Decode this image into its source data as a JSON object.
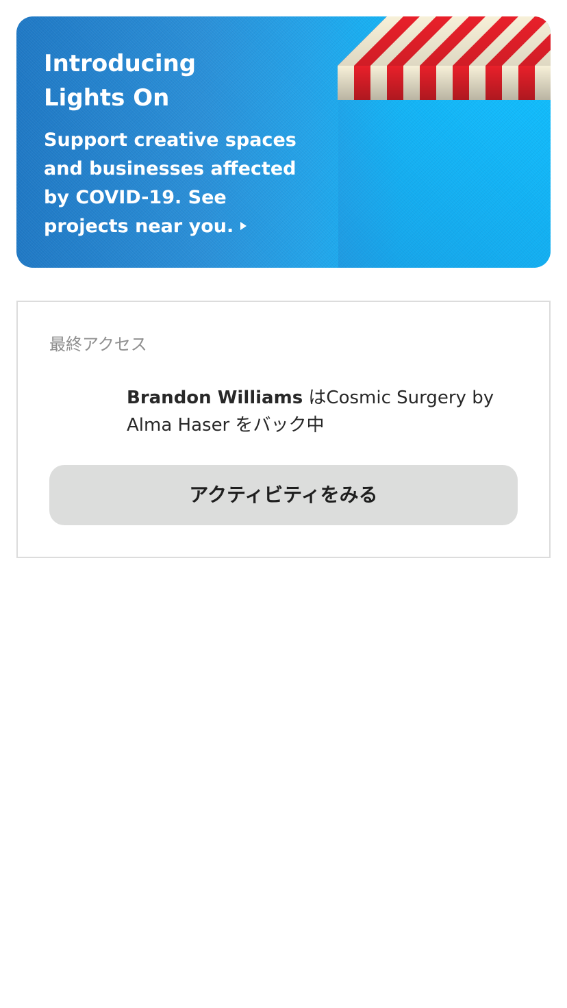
{
  "banner": {
    "title_line1": "Introducing",
    "title_line2": "Lights On",
    "body_line1": "Support creative spaces",
    "body_line2": "and businesses affected",
    "body_line3": "by COVID-19. See",
    "body_line4": "projects near you.",
    "arrow_icon": "play-triangle-icon",
    "illustration_icon": "striped-awning-icon",
    "colors": {
      "gradient_start": "#1f78c4",
      "gradient_end": "#0fbaf9",
      "awning_red": "#e8202a",
      "awning_cream": "#f7f0d8"
    }
  },
  "activity": {
    "section_label": "最終アクセス",
    "user_name": "Brandon Williams",
    "action_line1": " はCosmic Surgery by",
    "action_line2": "Alma Haser をバック中",
    "button_label": "アクティビティをみる",
    "colors": {
      "button_bg": "#dcdddc",
      "label_gray": "#8f8f8f",
      "border": "#dcdcdc"
    }
  }
}
